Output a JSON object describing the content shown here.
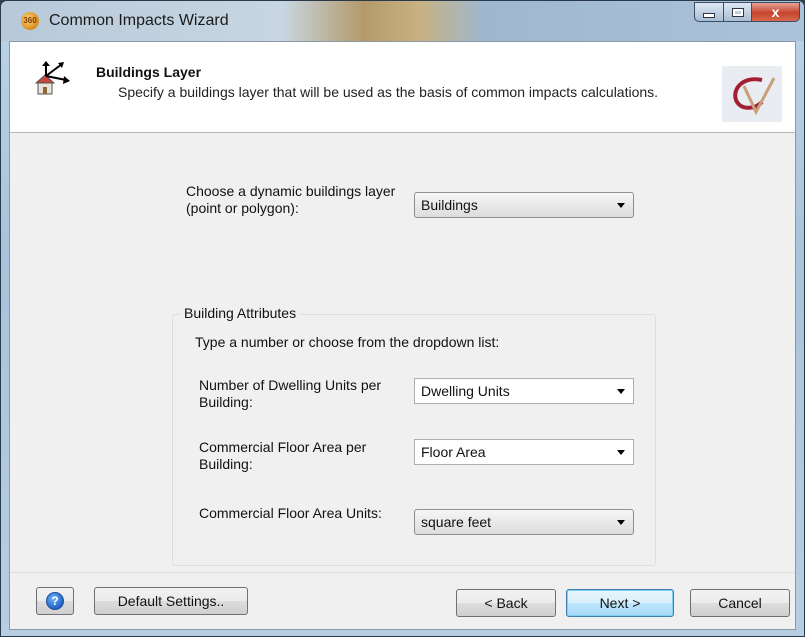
{
  "window": {
    "title": "Common Impacts Wizard",
    "app_icon_text": "360",
    "close_glyph": "x"
  },
  "header": {
    "title": "Buildings Layer",
    "description": "Specify a buildings layer that will be used as the basis of common impacts calculations."
  },
  "layer": {
    "label": "Choose a dynamic buildings layer (point or polygon):",
    "value": "Buildings"
  },
  "attributes": {
    "group_title": "Building Attributes",
    "instruction": "Type a number or choose from the dropdown list:",
    "dwelling_units": {
      "label": "Number of Dwelling Units per Building:",
      "value": "Dwelling Units"
    },
    "floor_area": {
      "label": "Commercial Floor Area per Building:",
      "value": "Floor Area"
    },
    "floor_area_units": {
      "label": "Commercial Floor Area Units:",
      "value": "square feet"
    }
  },
  "buttons": {
    "help": "?",
    "default_settings": "Default Settings..",
    "back": "< Back",
    "next": "Next >",
    "cancel": "Cancel"
  },
  "icons": {
    "wizard": "building-arrows-icon",
    "logo": "cv-logo",
    "help": "help-question-icon"
  }
}
